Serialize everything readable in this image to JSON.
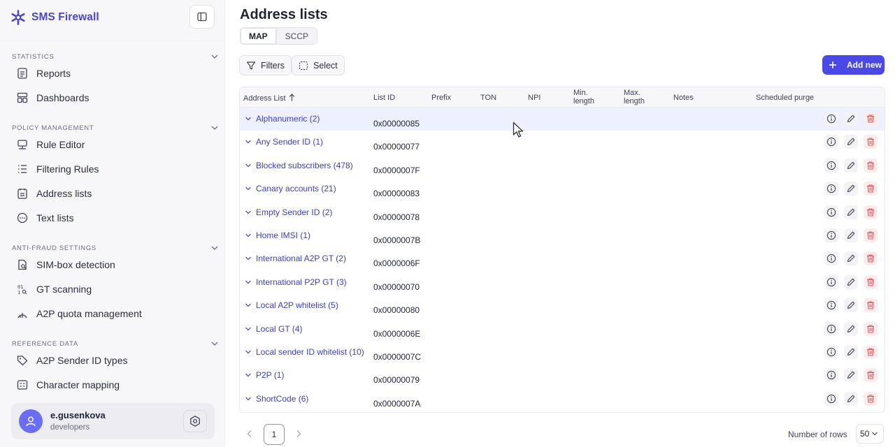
{
  "app": {
    "name": "SMS Firewall"
  },
  "sidebar": {
    "sections": [
      {
        "title": "STATISTICS",
        "items": [
          {
            "label": "Reports",
            "icon": "reports-icon"
          },
          {
            "label": "Dashboards",
            "icon": "dashboards-icon"
          }
        ]
      },
      {
        "title": "POLICY MANAGEMENT",
        "items": [
          {
            "label": "Rule Editor",
            "icon": "rule-editor-icon"
          },
          {
            "label": "Filtering Rules",
            "icon": "filtering-rules-icon"
          },
          {
            "label": "Address lists",
            "icon": "address-lists-icon"
          },
          {
            "label": "Text lists",
            "icon": "text-lists-icon"
          }
        ]
      },
      {
        "title": "ANTI-FRAUD SETTINGS",
        "items": [
          {
            "label": "SIM-box detection",
            "icon": "sim-box-icon"
          },
          {
            "label": "GT scanning",
            "icon": "gt-scanning-icon"
          },
          {
            "label": "A2P quota management",
            "icon": "quota-icon"
          }
        ]
      },
      {
        "title": "REFERENCE DATA",
        "items": [
          {
            "label": "A2P Sender ID types",
            "icon": "tag-icon"
          },
          {
            "label": "Character mapping",
            "icon": "character-mapping-icon"
          }
        ]
      }
    ],
    "user": {
      "name": "e.gusenkova",
      "group": "developers"
    }
  },
  "main": {
    "title": "Address lists",
    "tabs": [
      {
        "label": "MAP",
        "active": true
      },
      {
        "label": "SCCP",
        "active": false
      }
    ],
    "toolbar": {
      "filters_label": "Filters",
      "select_label": "Select",
      "add_label": "Add new"
    },
    "table": {
      "columns": [
        "Address List",
        "List ID",
        "Prefix",
        "TON",
        "NPI",
        "Min.\nlength",
        "Max.\nlength",
        "Notes",
        "Scheduled purge"
      ],
      "rows": [
        {
          "name": "Alphanumeric (2)",
          "id": "0x00000085"
        },
        {
          "name": "Any Sender ID (1)",
          "id": "0x00000077"
        },
        {
          "name": "Blocked subscribers (478)",
          "id": "0x0000007F"
        },
        {
          "name": "Canary accounts (21)",
          "id": "0x00000083"
        },
        {
          "name": "Empty Sender ID (2)",
          "id": "0x00000078"
        },
        {
          "name": "Home IMSI (1)",
          "id": "0x0000007B"
        },
        {
          "name": "International A2P GT (2)",
          "id": "0x0000006F"
        },
        {
          "name": "International P2P GT (3)",
          "id": "0x00000070"
        },
        {
          "name": "Local A2P whitelist (5)",
          "id": "0x00000080"
        },
        {
          "name": "Local GT (4)",
          "id": "0x0000006E"
        },
        {
          "name": "Local sender ID whitelist (10)",
          "id": "0x0000007C"
        },
        {
          "name": "P2P (1)",
          "id": "0x00000079"
        },
        {
          "name": "ShortCode (6)",
          "id": "0x0000007A"
        }
      ]
    },
    "pagination": {
      "page": "1",
      "rows_label": "Number of rows",
      "rows_value": "50"
    }
  },
  "colors": {
    "accent": "#4a49e6",
    "link": "#3c3fb3",
    "danger": "#e0525a"
  }
}
